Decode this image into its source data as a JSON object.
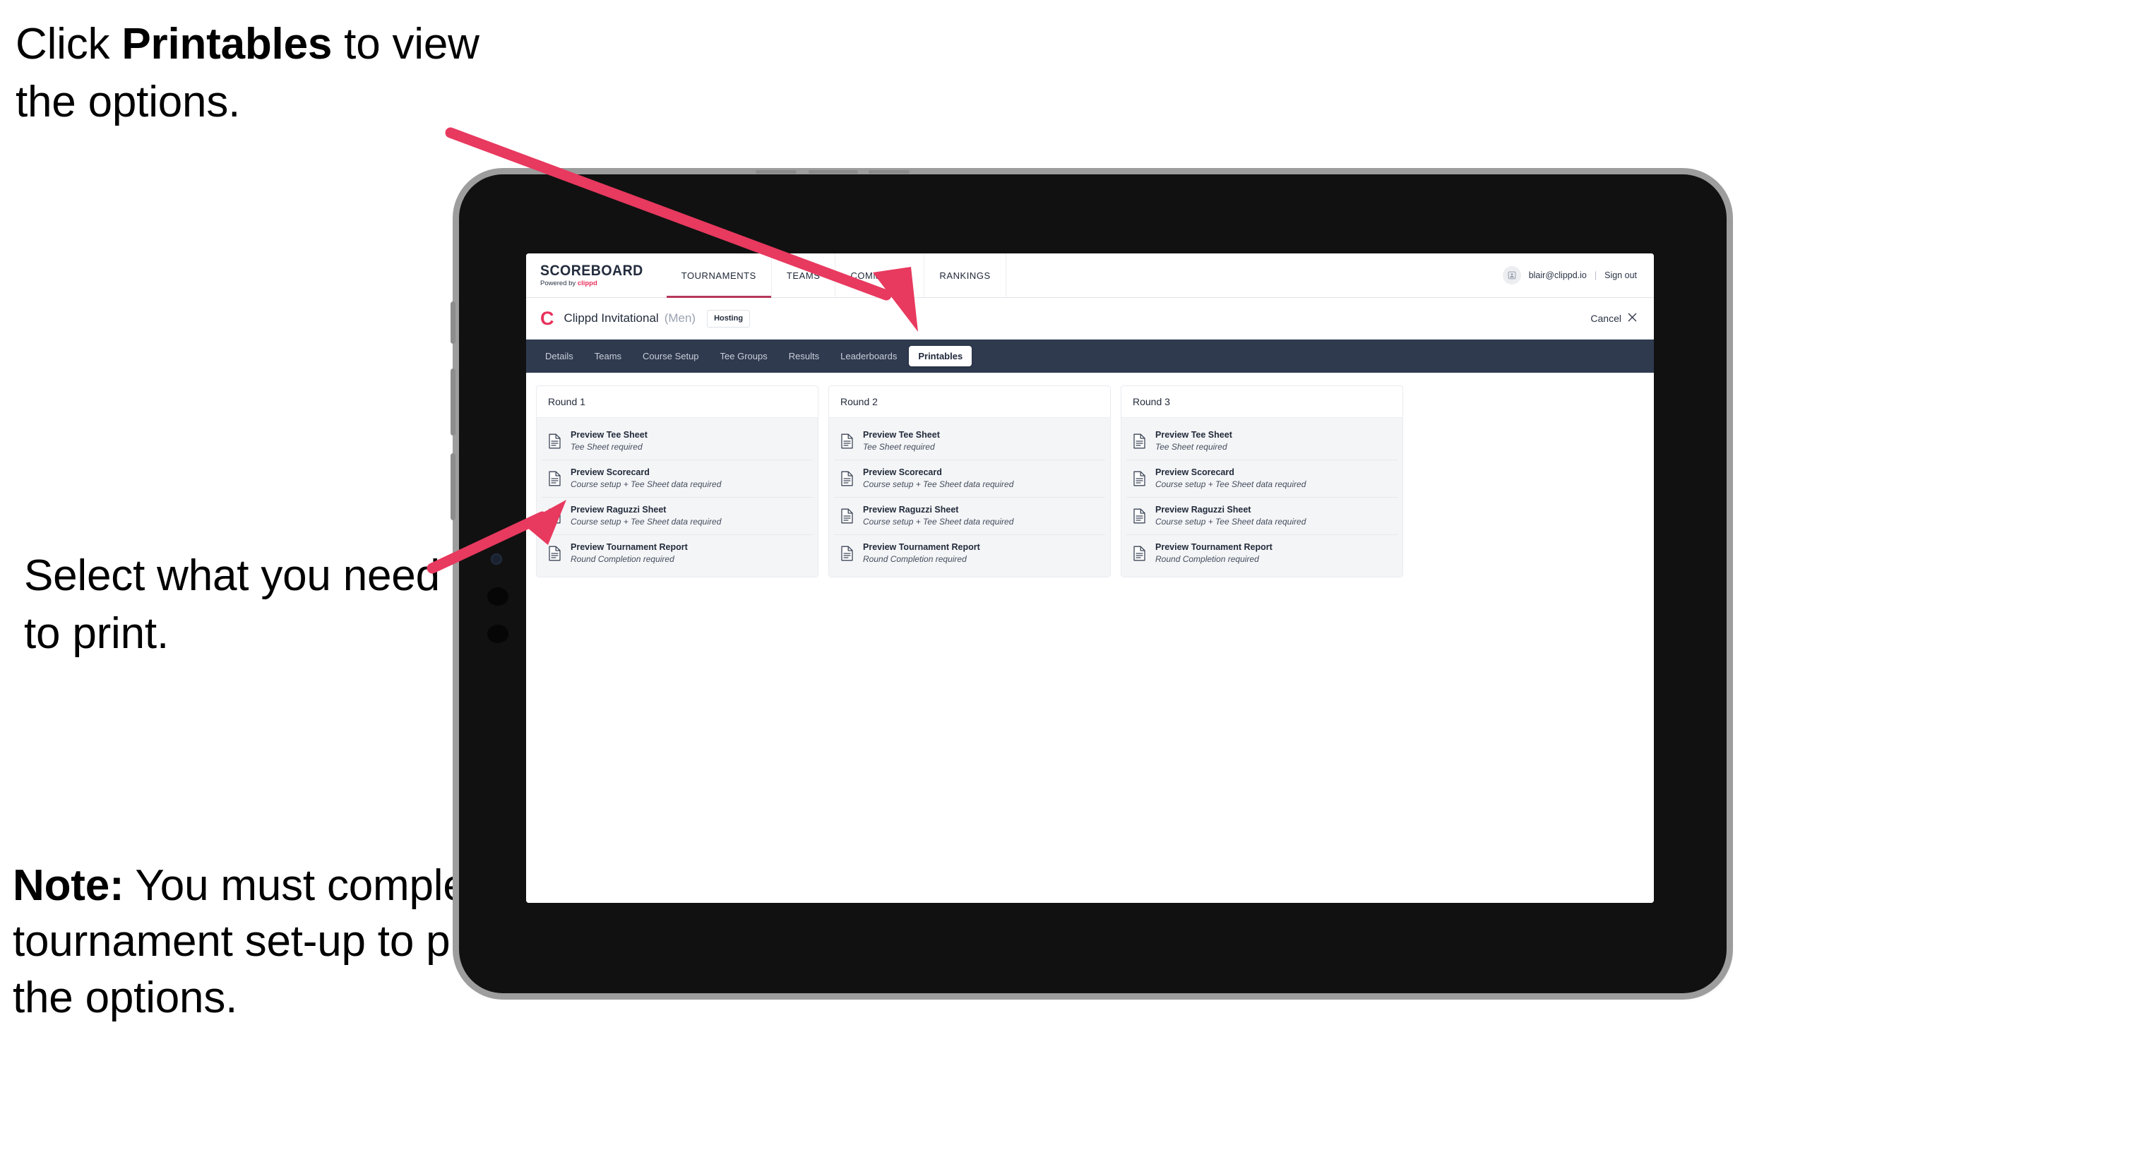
{
  "annotations": {
    "top": {
      "pre": "Click ",
      "bold": "Printables",
      "post": " to view the options."
    },
    "middle": "Select what you need to print.",
    "note": {
      "bold": "Note:",
      "rest": " You must complete the tournament set-up to print all the options."
    }
  },
  "colors": {
    "accent_pink": "#e8315c",
    "arrow_pink": "#e8395f",
    "tab_strip": "#2f3a4f",
    "dark_text": "#222b3b"
  },
  "site_bar": {
    "brand_title": "SCOREBOARD",
    "brand_sub_prefix": "Powered by ",
    "brand_sub_name": "clippd",
    "nav": [
      {
        "label": "TOURNAMENTS",
        "active": true
      },
      {
        "label": "TEAMS",
        "active": false
      },
      {
        "label": "COMMITTEE",
        "active": false
      },
      {
        "label": "RANKINGS",
        "active": false
      }
    ],
    "avatar_icon": "user-avatar-icon",
    "user_email": "blair@clippd.io",
    "separator": "|",
    "sign_out": "Sign out"
  },
  "tournament_bar": {
    "logo_letter": "C",
    "name": "Clippd Invitational",
    "gender": "(Men)",
    "hosting_badge": "Hosting",
    "cancel_label": "Cancel",
    "cancel_icon": "close-icon"
  },
  "tabs": [
    {
      "label": "Details",
      "selected": false
    },
    {
      "label": "Teams",
      "selected": false
    },
    {
      "label": "Course Setup",
      "selected": false
    },
    {
      "label": "Tee Groups",
      "selected": false
    },
    {
      "label": "Results",
      "selected": false
    },
    {
      "label": "Leaderboards",
      "selected": false
    },
    {
      "label": "Printables",
      "selected": true
    }
  ],
  "rounds": [
    {
      "heading": "Round 1",
      "items": [
        {
          "title": "Preview Tee Sheet",
          "subtitle": "Tee Sheet required"
        },
        {
          "title": "Preview Scorecard",
          "subtitle": "Course setup + Tee Sheet data required"
        },
        {
          "title": "Preview Raguzzi Sheet",
          "subtitle": "Course setup + Tee Sheet data required"
        },
        {
          "title": "Preview Tournament Report",
          "subtitle": "Round Completion required"
        }
      ]
    },
    {
      "heading": "Round 2",
      "items": [
        {
          "title": "Preview Tee Sheet",
          "subtitle": "Tee Sheet required"
        },
        {
          "title": "Preview Scorecard",
          "subtitle": "Course setup + Tee Sheet data required"
        },
        {
          "title": "Preview Raguzzi Sheet",
          "subtitle": "Course setup + Tee Sheet data required"
        },
        {
          "title": "Preview Tournament Report",
          "subtitle": "Round Completion required"
        }
      ]
    },
    {
      "heading": "Round 3",
      "items": [
        {
          "title": "Preview Tee Sheet",
          "subtitle": "Tee Sheet required"
        },
        {
          "title": "Preview Scorecard",
          "subtitle": "Course setup + Tee Sheet data required"
        },
        {
          "title": "Preview Raguzzi Sheet",
          "subtitle": "Course setup + Tee Sheet data required"
        },
        {
          "title": "Preview Tournament Report",
          "subtitle": "Round Completion required"
        }
      ]
    }
  ]
}
